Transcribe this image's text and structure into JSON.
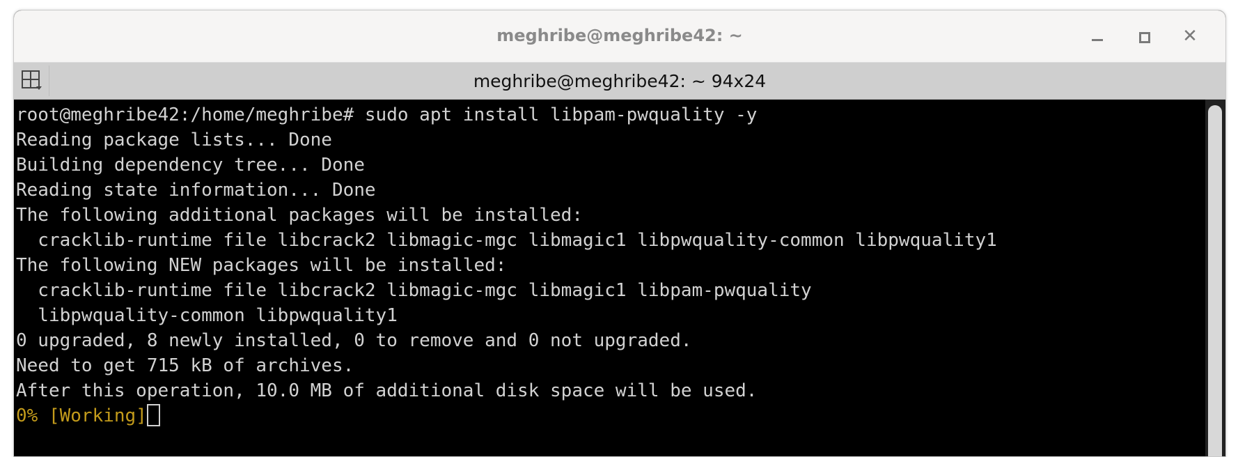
{
  "window": {
    "title": "meghribe@meghribe42: ~"
  },
  "controls": {
    "minimize_icon": "minimize-icon",
    "maximize_icon": "maximize-icon",
    "close_icon": "close-icon",
    "close_glyph": "✕"
  },
  "tab": {
    "menu_icon": "tab-menu-icon",
    "title": "meghribe@meghribe42: ~ 94x24"
  },
  "colors": {
    "terminal_bg": "#000000",
    "terminal_fg": "#d2d2d2",
    "progress_yellow": "#c39b1b",
    "titlebar_bg": "#f6f5f4",
    "tabbar_bg": "#cfcfcf"
  },
  "terminal": {
    "lines": [
      "root@meghribe42:/home/meghribe# sudo apt install libpam-pwquality -y",
      "Reading package lists... Done",
      "Building dependency tree... Done",
      "Reading state information... Done",
      "The following additional packages will be installed:",
      "  cracklib-runtime file libcrack2 libmagic-mgc libmagic1 libpwquality-common libpwquality1",
      "The following NEW packages will be installed:",
      "  cracklib-runtime file libcrack2 libmagic-mgc libmagic1 libpam-pwquality",
      "  libpwquality-common libpwquality1",
      "0 upgraded, 8 newly installed, 0 to remove and 0 not upgraded.",
      "Need to get 715 kB of archives.",
      "After this operation, 10.0 MB of additional disk space will be used."
    ],
    "progress_line": "0% [Working]"
  }
}
